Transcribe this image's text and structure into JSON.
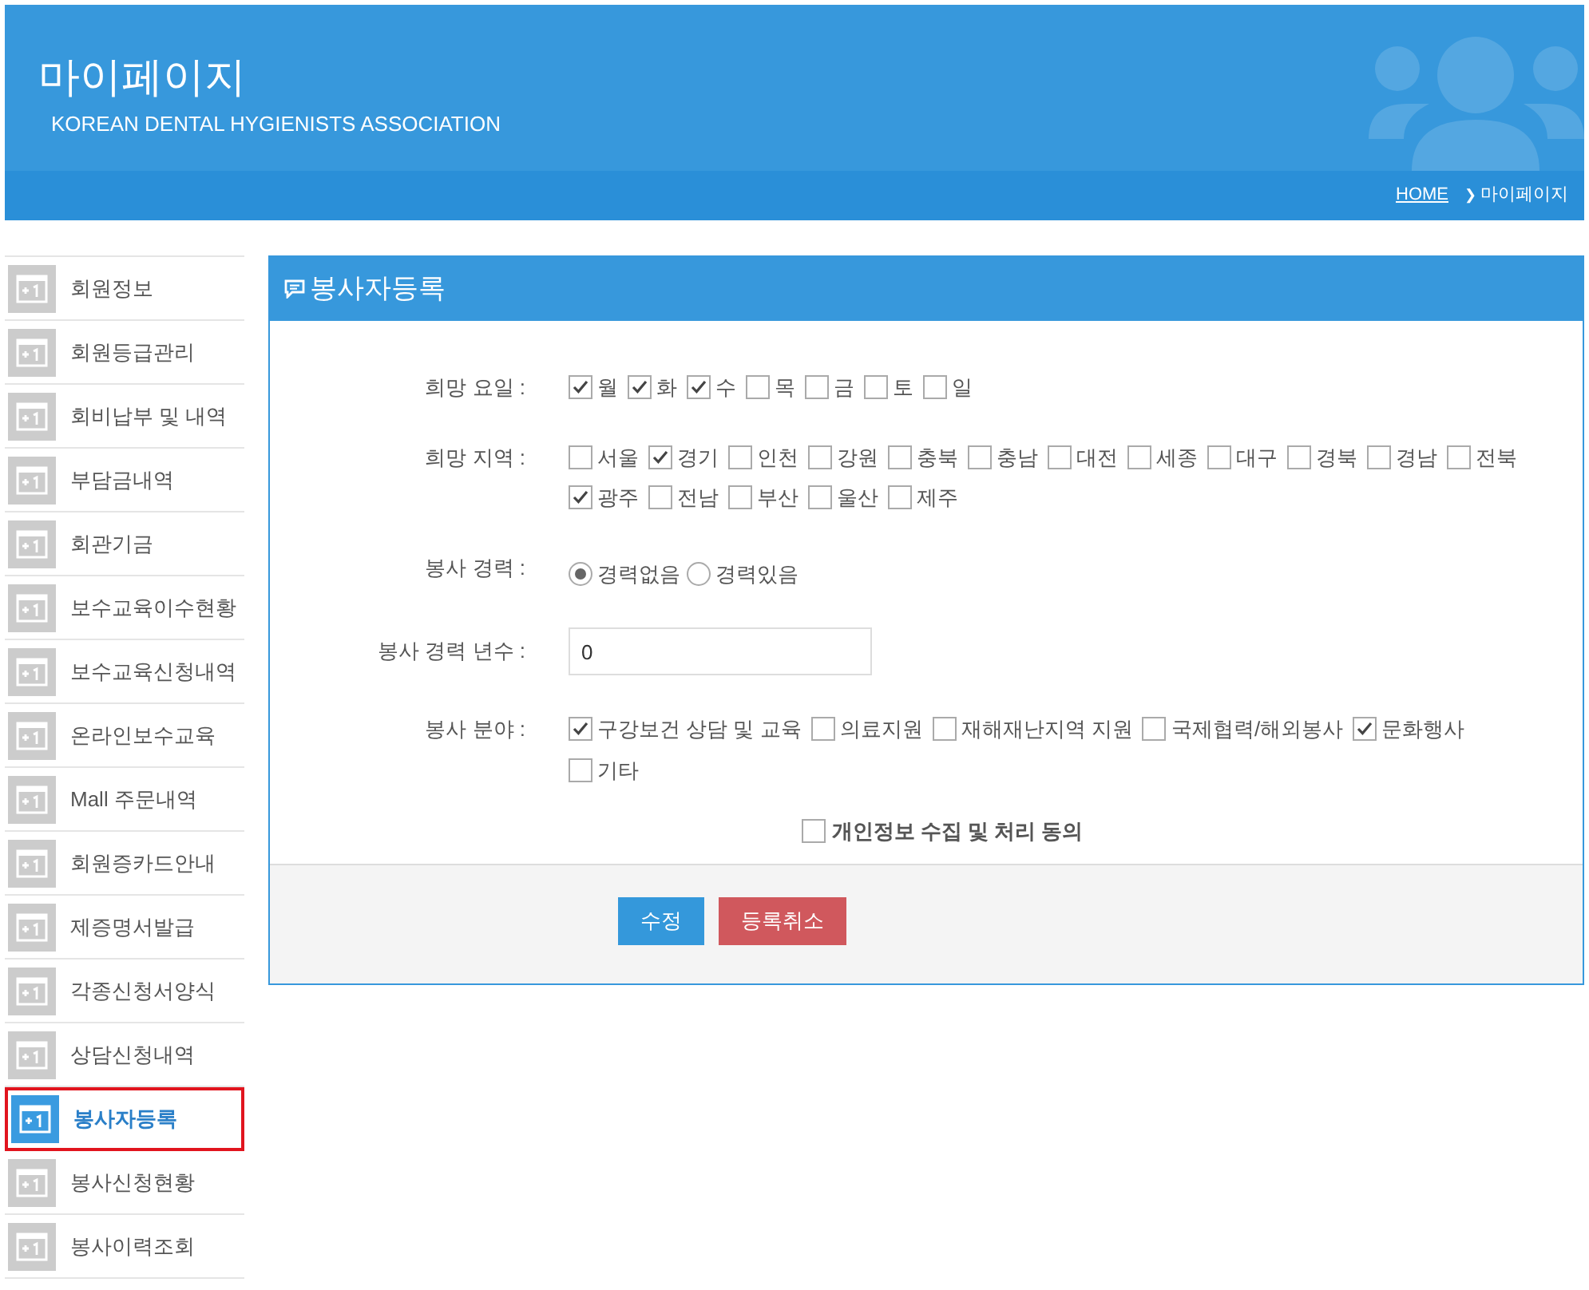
{
  "header": {
    "title": "마이페이지",
    "subtitle": "KOREAN DENTAL HYGIENISTS ASSOCIATION"
  },
  "breadcrumb": {
    "home": "HOME",
    "separator": "❯",
    "current": "마이페이지"
  },
  "sidebar": {
    "items": [
      {
        "label": "회원정보",
        "selected": false
      },
      {
        "label": "회원등급관리",
        "selected": false
      },
      {
        "label": "회비납부 및 내역",
        "selected": false
      },
      {
        "label": "부담금내역",
        "selected": false
      },
      {
        "label": "회관기금",
        "selected": false
      },
      {
        "label": "보수교육이수현황",
        "selected": false
      },
      {
        "label": "보수교육신청내역",
        "selected": false
      },
      {
        "label": "온라인보수교육",
        "selected": false
      },
      {
        "label": "Mall 주문내역",
        "selected": false
      },
      {
        "label": "회원증카드안내",
        "selected": false
      },
      {
        "label": "제증명서발급",
        "selected": false
      },
      {
        "label": "각종신청서양식",
        "selected": false
      },
      {
        "label": "상담신청내역",
        "selected": false
      },
      {
        "label": "봉사자등록",
        "selected": true
      },
      {
        "label": "봉사신청현황",
        "selected": false
      },
      {
        "label": "봉사이력조회",
        "selected": false
      }
    ]
  },
  "panel": {
    "title": "봉사자등록",
    "rows": [
      {
        "label": "희망 요일 :",
        "kind": "checkboxes",
        "options": [
          {
            "label": "월",
            "checked": true
          },
          {
            "label": "화",
            "checked": true
          },
          {
            "label": "수",
            "checked": true
          },
          {
            "label": "목",
            "checked": false
          },
          {
            "label": "금",
            "checked": false
          },
          {
            "label": "토",
            "checked": false
          },
          {
            "label": "일",
            "checked": false
          }
        ]
      },
      {
        "label": "희망 지역 :",
        "kind": "checkboxes",
        "options": [
          {
            "label": "서울",
            "checked": false
          },
          {
            "label": "경기",
            "checked": true
          },
          {
            "label": "인천",
            "checked": false
          },
          {
            "label": "강원",
            "checked": false
          },
          {
            "label": "충북",
            "checked": false
          },
          {
            "label": "충남",
            "checked": false
          },
          {
            "label": "대전",
            "checked": false
          },
          {
            "label": "세종",
            "checked": false
          },
          {
            "label": "대구",
            "checked": false
          },
          {
            "label": "경북",
            "checked": false
          },
          {
            "label": "경남",
            "checked": false
          },
          {
            "label": "전북",
            "checked": false
          },
          {
            "label": "광주",
            "checked": true
          },
          {
            "label": "전남",
            "checked": false
          },
          {
            "label": "부산",
            "checked": false
          },
          {
            "label": "울산",
            "checked": false
          },
          {
            "label": "제주",
            "checked": false
          }
        ]
      },
      {
        "label": "봉사 경력 :",
        "kind": "radios",
        "options": [
          {
            "label": "경력없음",
            "selected": true
          },
          {
            "label": "경력있음",
            "selected": false
          }
        ]
      },
      {
        "label": "봉사 경력 년수 :",
        "kind": "text",
        "value": "0"
      },
      {
        "label": "봉사 분야 :",
        "kind": "checkboxes",
        "options": [
          {
            "label": "구강보건 상담 및 교육",
            "checked": true
          },
          {
            "label": "의료지원",
            "checked": false
          },
          {
            "label": "재해재난지역 지원",
            "checked": false
          },
          {
            "label": "국제협력/해외봉사",
            "checked": false
          },
          {
            "label": "문화행사",
            "checked": true
          },
          {
            "label": "기타",
            "checked": false
          }
        ]
      }
    ],
    "consent": {
      "label": "개인정보 수집 및 처리 동의",
      "checked": false
    },
    "buttons": [
      {
        "label": "수정",
        "kind": "primary"
      },
      {
        "label": "등록취소",
        "kind": "danger"
      }
    ]
  }
}
